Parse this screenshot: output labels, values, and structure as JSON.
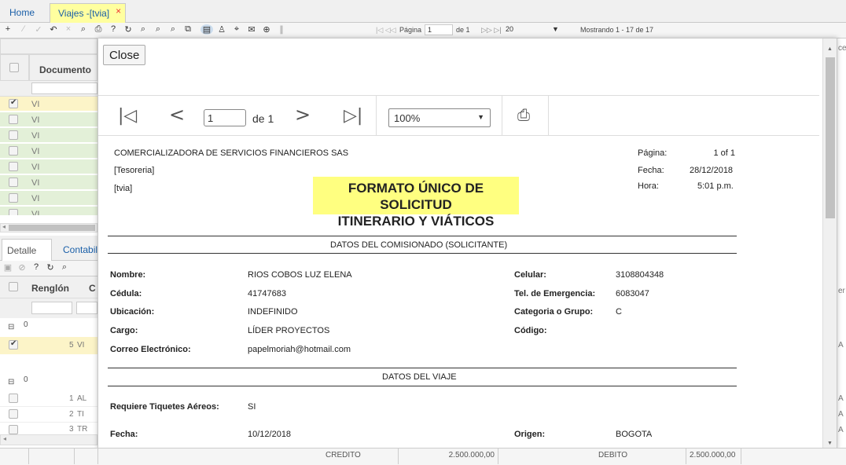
{
  "tabs": {
    "home": "Home",
    "viajes": "Viajes -[tvia]",
    "close": "×"
  },
  "toolbar": {
    "page_label": "Página",
    "page_value": "1",
    "of_label": "de 1",
    "per_page": "20",
    "showing": "Mostrando 1 - 17 de 17"
  },
  "grid": {
    "header_documento": "Documento",
    "rows": [
      "VI",
      "VI",
      "VI",
      "VI",
      "VI",
      "VI",
      "VI",
      "VI"
    ]
  },
  "detail": {
    "tab_detalle": "Detalle",
    "tab_contabil": "Contabil",
    "col_renglon": "Renglón",
    "col_c": "C",
    "group1": "0",
    "group1_row_num": "5",
    "group1_row_code": "VI",
    "group2": "0",
    "rows": [
      {
        "num": "1",
        "code": "AL"
      },
      {
        "num": "2",
        "code": "TI"
      },
      {
        "num": "3",
        "code": "TR"
      }
    ]
  },
  "modal": {
    "close_label": "Close",
    "viewer": {
      "page_value": "1",
      "of_label": "de 1",
      "zoom": "100%"
    },
    "report": {
      "company": "COMERCIALIZADORA DE SERVICIOS FINANCIEROS SAS",
      "dept": "[Tesoreria]",
      "code": "[tvia]",
      "title_line1": "FORMATO ÚNICO DE SOLICITUD",
      "title_line2": "ITINERARIO Y VIÁTICOS",
      "page_label": "Página:",
      "page_value": "1 of 1",
      "date_label": "Fecha:",
      "date_value": "28/12/2018",
      "time_label": "Hora:",
      "time_value": "5:01 p.m.",
      "section1": "DATOS DEL COMISIONADO (SOLICITANTE)",
      "nombre_label": "Nombre:",
      "nombre_value": "RIOS COBOS LUZ ELENA",
      "cedula_label": "Cédula:",
      "cedula_value": "41747683",
      "ubicacion_label": "Ubicación:",
      "ubicacion_value": "INDEFINIDO",
      "cargo_label": "Cargo:",
      "cargo_value": "LÍDER PROYECTOS",
      "correo_label": "Correo Electrónico:",
      "correo_value": "papelmoriah@hotmail.com",
      "celular_label": "Celular:",
      "celular_value": "3108804348",
      "tel_label": "Tel. de Emergencia:",
      "tel_value": "6083047",
      "categoria_label": "Categoria o Grupo:",
      "categoria_value": "C",
      "codigo_label": "Código:",
      "section2": "DATOS DEL VIAJE",
      "tiquetes_label": "Requiere Tiquetes Aéreos:",
      "tiquetes_value": "SI",
      "fecha_label": "Fecha:",
      "fecha_value": "10/12/2018",
      "origen_label": "Origen:",
      "origen_value": "BOGOTA"
    }
  },
  "bottom": {
    "credito_label": "CREDITO",
    "credito_value": "2.500.000,00",
    "debito_label": "DEBITO",
    "debito_value": "2.500.000,00"
  }
}
